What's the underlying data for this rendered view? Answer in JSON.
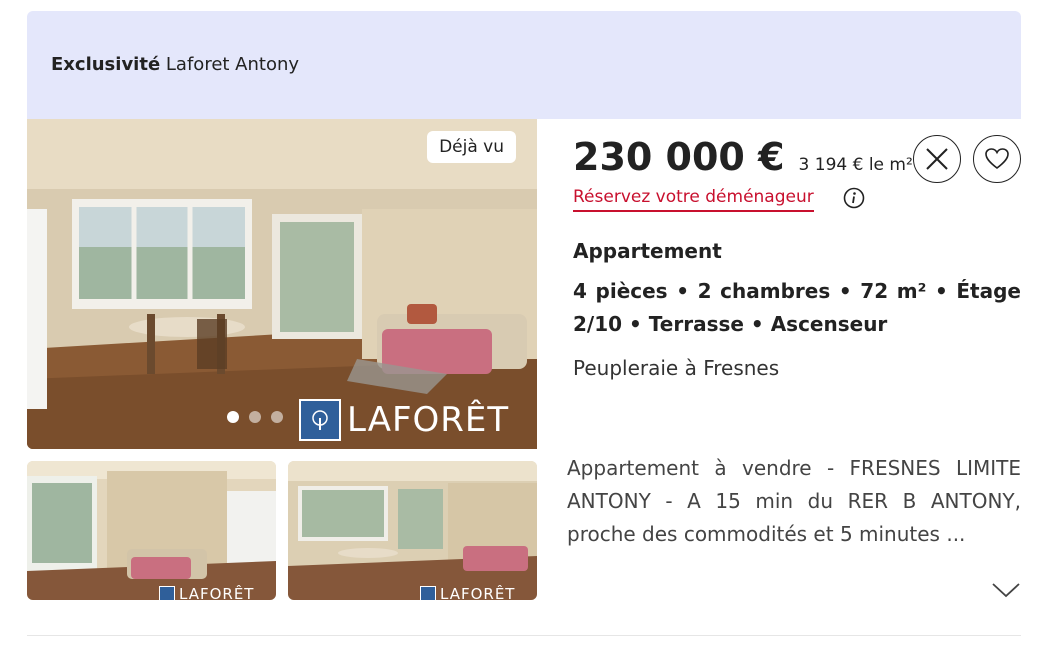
{
  "agency": {
    "exclusive_label": "Exclusivité",
    "name": "Laforet Antony"
  },
  "gallery": {
    "seen_badge": "Déjà vu",
    "dot_count": 3,
    "active_dot": 0,
    "watermark": "LAFORÊT"
  },
  "listing": {
    "price": "230 000 €",
    "price_per_sqm": "3 194 € le m²",
    "mover_link": "Réservez votre déménageur",
    "property_type": "Appartement",
    "features": [
      "4 pièces",
      "2 chambres",
      "72 m²",
      "Étage 2/10",
      "Terrasse",
      "Ascenseur"
    ],
    "feature_separator": "•",
    "location": "Peupleraie à Fresnes",
    "description": "Appartement à vendre - FRESNES LIMITE ANTONY - A 15 min du RER B ANTONY, proche des commodités et 5 minutes ..."
  },
  "icons": {
    "dismiss": "close-icon",
    "favorite": "heart-icon",
    "info": "info-icon",
    "expand": "chevron-down-icon"
  },
  "colors": {
    "agency_bar": "#e4e7fb",
    "link_red": "#c8102e",
    "logo_blue": "#2f5f9a"
  }
}
